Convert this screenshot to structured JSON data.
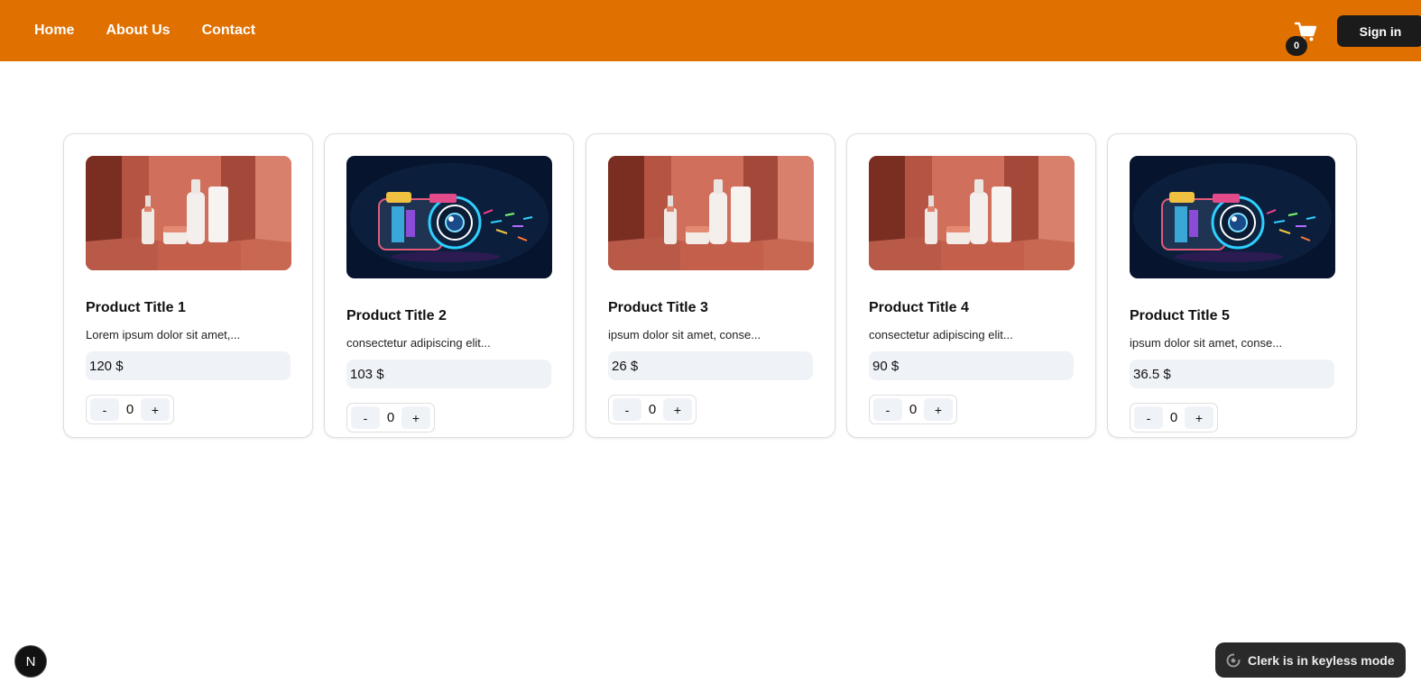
{
  "nav": {
    "items": [
      {
        "label": "Home"
      },
      {
        "label": "About Us"
      },
      {
        "label": "Contact"
      }
    ],
    "cart_count": "0",
    "signin_label": "Sign in",
    "brand_color": "#e07000"
  },
  "products": [
    {
      "title": "Product Title 1",
      "description": "Lorem ipsum dolor sit amet,...",
      "price": "120 $",
      "qty": "0",
      "image": "cosmetics-bottles"
    },
    {
      "title": "Product Title 2",
      "description": "consectetur adipiscing elit...",
      "price": "103 $",
      "qty": "0",
      "image": "neon-camera"
    },
    {
      "title": "Product Title 3",
      "description": "ipsum dolor sit amet, conse...",
      "price": "26 $",
      "qty": "0",
      "image": "cosmetics-bottles"
    },
    {
      "title": "Product Title 4",
      "description": "consectetur adipiscing elit...",
      "price": "90 $",
      "qty": "0",
      "image": "cosmetics-bottles"
    },
    {
      "title": "Product Title 5",
      "description": "ipsum dolor sit amet, conse...",
      "price": "36.5 $",
      "qty": "0",
      "image": "neon-camera"
    }
  ],
  "stepper": {
    "minus": "-",
    "plus": "+"
  },
  "footer": {
    "next_badge": "N",
    "clerk_notice": "Clerk is in keyless mode"
  }
}
